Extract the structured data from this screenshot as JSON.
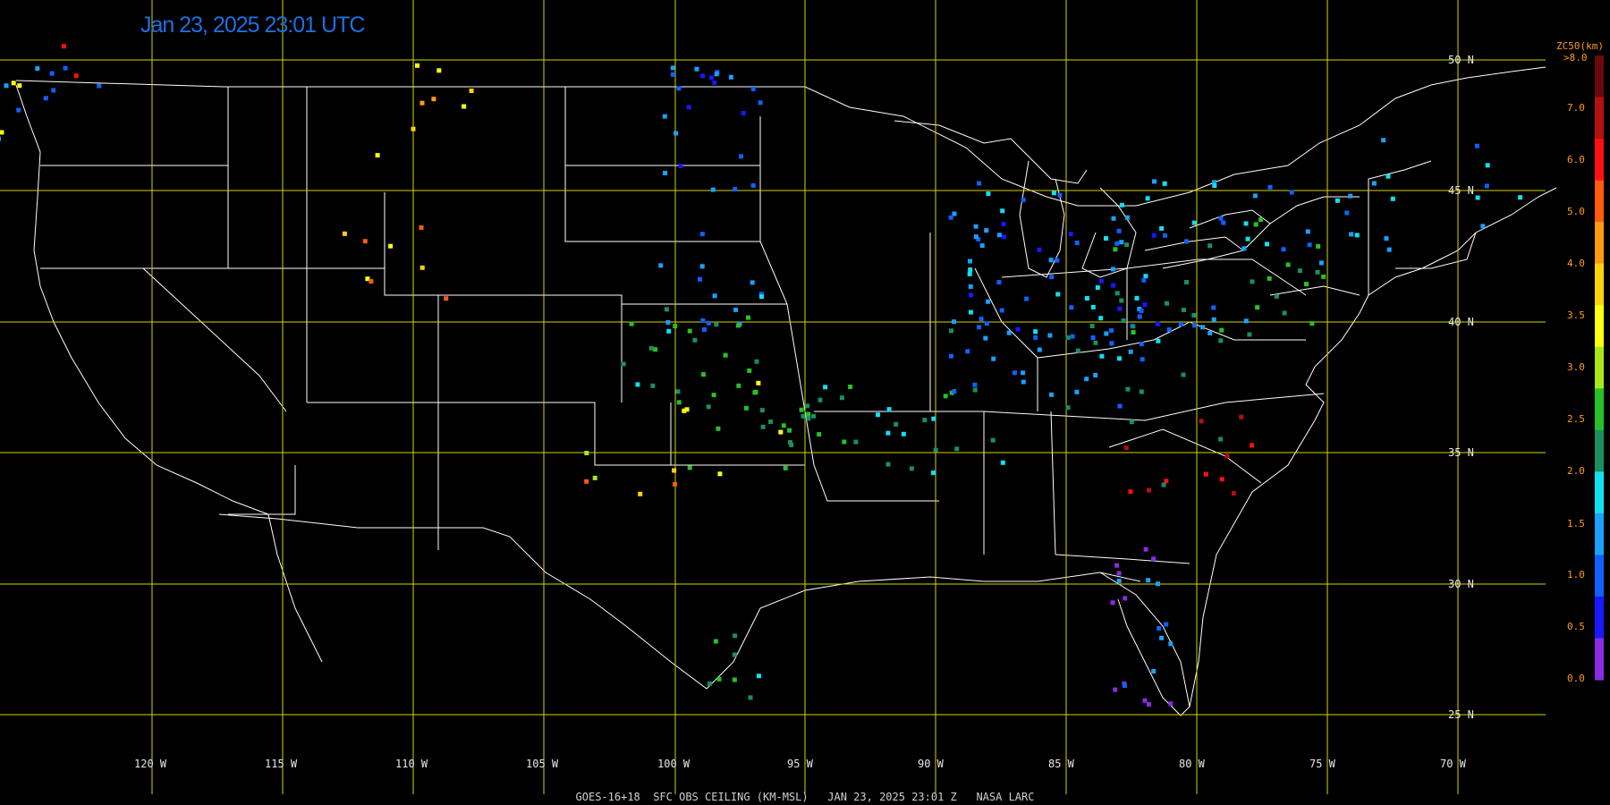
{
  "map": {
    "timestamp": "Jan 23, 2025 23:01 UTC",
    "footer": "GOES-16+18  SFC OBS CEILING (KM-MSL)   JAN 23, 2025 23:01 Z   NASA LARC",
    "lat_lines": [
      "50 N",
      "45 N",
      "40 N",
      "35 N",
      "30 N",
      "25 N"
    ],
    "lon_lines": [
      "120 W",
      "115 W",
      "110 W",
      "105 W",
      "100 W",
      "95 W",
      "90 W",
      "85 W",
      "80 W",
      "75 W",
      "70 W"
    ],
    "grid_color": "#d4d400",
    "border_color": "#ffffff"
  },
  "legend": {
    "title": "ZC50(km)",
    "top_label": ">8.0",
    "labels": [
      "7.0",
      "6.0",
      "5.0",
      "4.0",
      "3.5",
      "3.0",
      "2.5",
      "2.0",
      "1.5",
      "1.0",
      "0.5",
      "0.0"
    ],
    "colors": [
      "#6b0a0a",
      "#b31010",
      "#ff1010",
      "#ff5a10",
      "#ff9a10",
      "#ffd20a",
      "#ffff10",
      "#a8e81a",
      "#28c028",
      "#189060",
      "#10e0f0",
      "#1aa0ff",
      "#1060ff",
      "#1818ff",
      "#8a2be2"
    ]
  }
}
